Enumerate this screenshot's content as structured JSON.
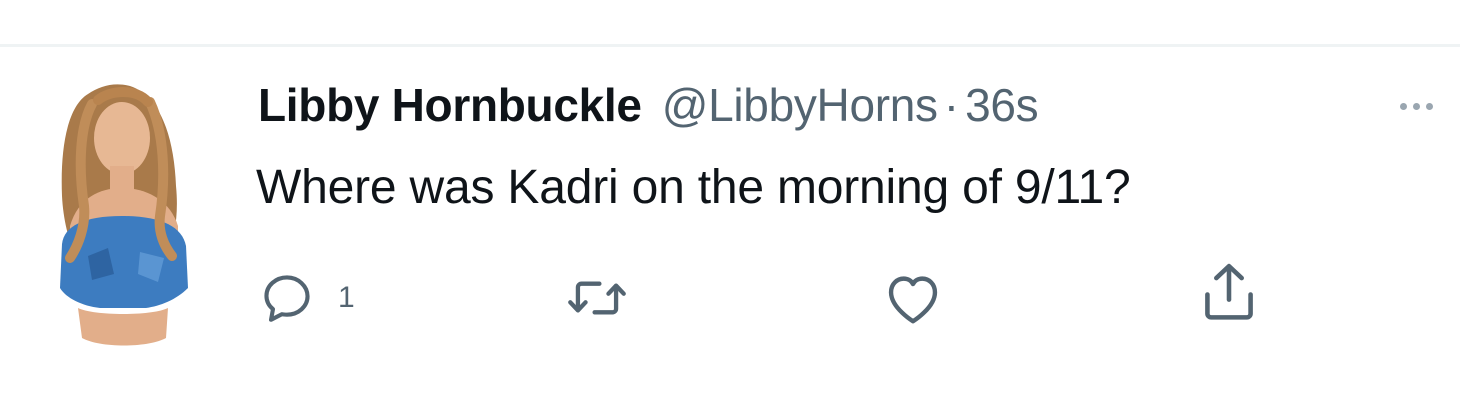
{
  "tweet": {
    "display_name": "Libby Hornbuckle",
    "handle": "@LibbyHorns",
    "separator": "·",
    "time": "36s",
    "text": "Where was Kadri on the morning of 9/11?",
    "actions": {
      "reply_count": "1"
    }
  },
  "icons": {
    "reply": "reply-icon",
    "retweet": "retweet-icon",
    "like": "heart-icon",
    "share": "share-icon",
    "more": "more-icon"
  },
  "colors": {
    "text_primary": "#0f1419",
    "text_secondary": "#536471",
    "divider": "#eff3f4"
  }
}
